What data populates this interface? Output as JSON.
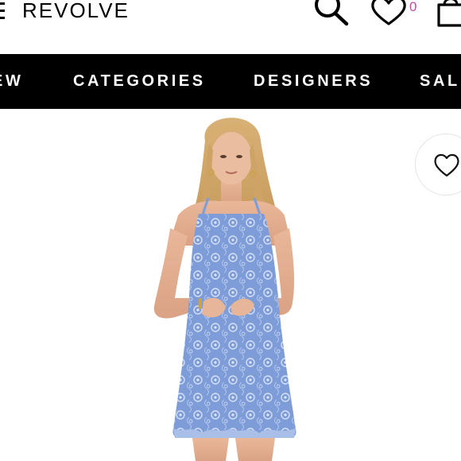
{
  "header": {
    "brand": "REVOLVE",
    "wishlist_count": "0",
    "icons": {
      "menu": "hamburger-menu-icon",
      "search": "search-icon",
      "wishlist": "heart-icon",
      "bag": "shopping-bag-icon"
    }
  },
  "nav": {
    "items": [
      {
        "label": "EW"
      },
      {
        "label": "CATEGORIES"
      },
      {
        "label": "DESIGNERS"
      },
      {
        "label": "SAL"
      }
    ]
  },
  "product": {
    "image": "model-in-blue-lace-halter-mini-dress",
    "dress_color": "#7f9ed8",
    "favorite_icon": "heart-icon"
  },
  "colors": {
    "nav_background": "#000000",
    "nav_text": "#ffffff",
    "wishlist_count": "#c74aa6"
  }
}
